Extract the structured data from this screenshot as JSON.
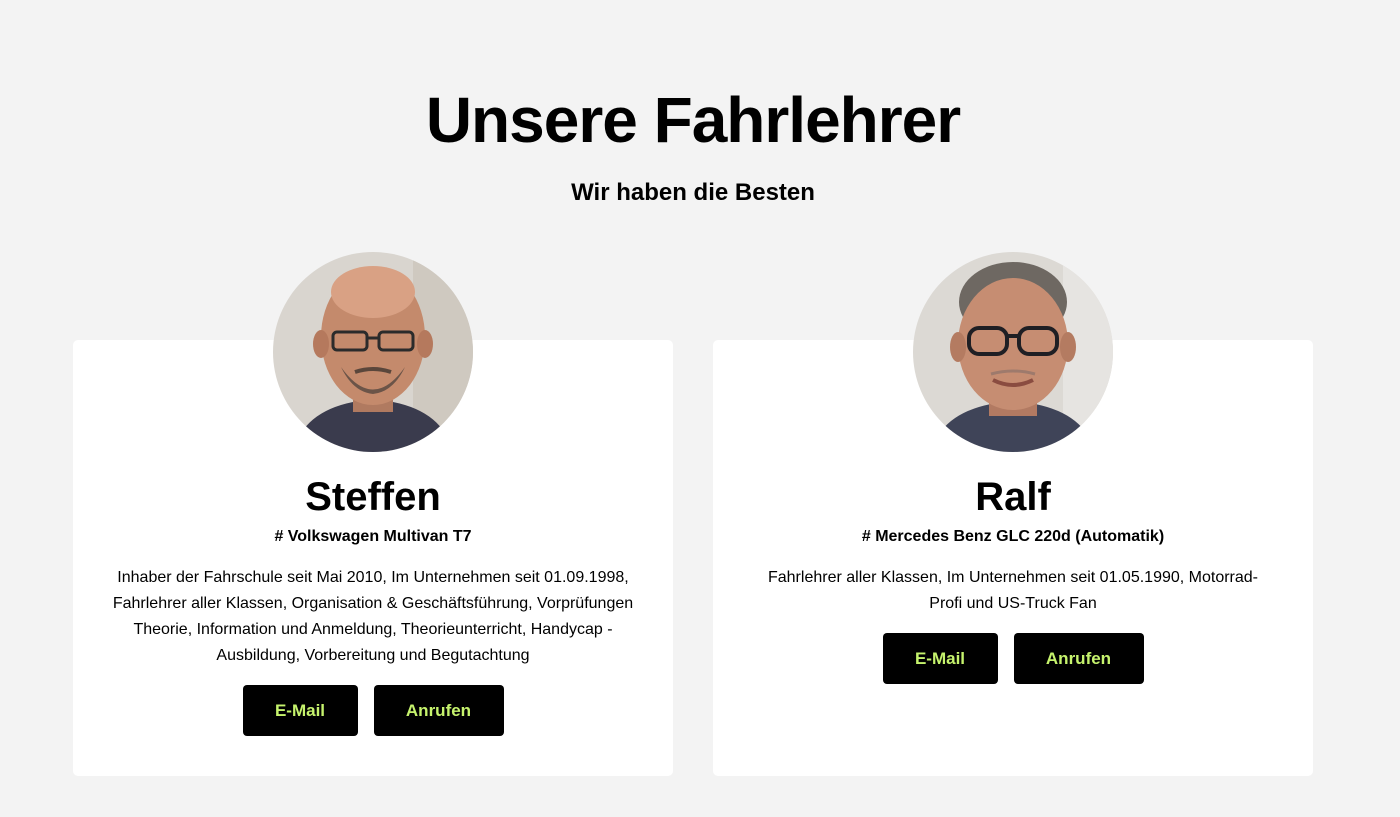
{
  "header": {
    "title": "Unsere Fahrlehrer",
    "subtitle": "Wir haben die Besten"
  },
  "instructors": [
    {
      "name": "Steffen",
      "car": "# Volkswagen Multivan T7",
      "description": "Inhaber der Fahrschule seit Mai 2010, Im Unternehmen seit 01.09.1998, Fahrlehrer aller Klassen, Organisation & Geschäftsführung, Vorprüfungen Theorie, Information und Anmeldung, Theorieunterricht, Handycap - Ausbildung, Vorbereitung und Begutachtung",
      "email_label": "E-Mail",
      "call_label": "Anrufen"
    },
    {
      "name": "Ralf",
      "car": "# Mercedes Benz GLC 220d (Automatik)",
      "description": "Fahrlehrer aller Klassen, Im Unternehmen seit 01.05.1990, Motorrad-Profi und US-Truck Fan",
      "email_label": "E-Mail",
      "call_label": "Anrufen"
    }
  ],
  "colors": {
    "background": "#f3f3f3",
    "card": "#ffffff",
    "button_bg": "#000000",
    "button_text": "#c6f36d"
  }
}
